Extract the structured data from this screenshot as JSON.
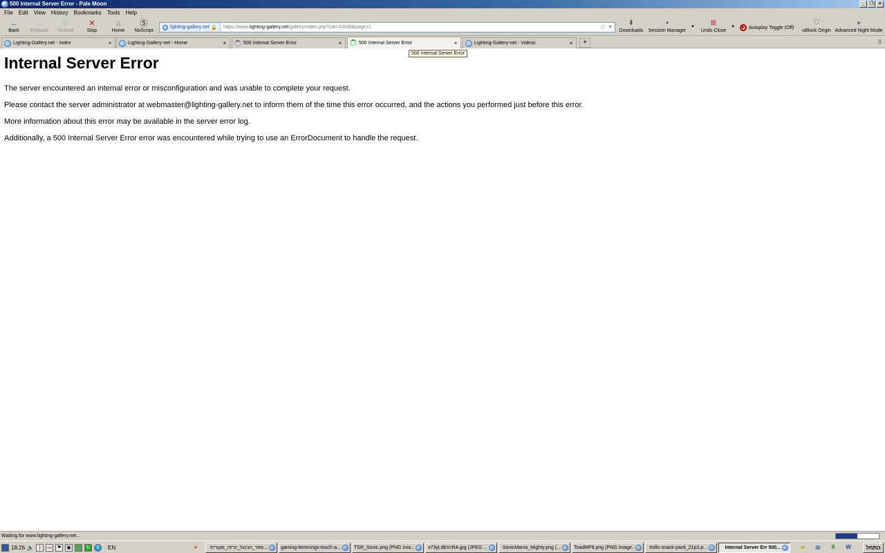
{
  "window": {
    "title": "500 Internal Server Error - Pale Moon",
    "controls": [
      "_",
      "❐",
      "×"
    ]
  },
  "menu": [
    "File",
    "Edit",
    "View",
    "History",
    "Bookmarks",
    "Tools",
    "Help"
  ],
  "nav": {
    "back": "Back",
    "forward": "Forward",
    "reload": "Reload",
    "stop": "Stop",
    "home": "Home",
    "noscript": "NoScript"
  },
  "urlbar": {
    "identity": "lighting-gallery.net",
    "url_prefix": "https://www.",
    "url_domain": "lighting-gallery.net",
    "url_path": "/gallery/index.php?cat=10338&page=1"
  },
  "toolbar": {
    "downloads": "Downloads",
    "session_manager": "Session Manager",
    "undo_close": "Undo Close",
    "autoplay": "Autoplay Toggle (Off)",
    "ublock": "uBlock Origin",
    "night_mode": "Advanced Night Mode"
  },
  "tabs": [
    {
      "title": "Lighting-Gallery.net - Index",
      "icon": "globe"
    },
    {
      "title": "Lighting-Gallery-net - Home",
      "icon": "globe"
    },
    {
      "title": "500 Internal Server Error",
      "icon": "spinner-grey"
    },
    {
      "title": "500 Internal Server Error",
      "icon": "spinner-green",
      "active": true
    },
    {
      "title": "Lighting-Gallery-net - Videos",
      "icon": "globe"
    }
  ],
  "tooltip": "500 Internal Server Error",
  "page": {
    "heading": "Internal Server Error",
    "p1": "The server encountered an internal error or misconfiguration and was unable to complete your request.",
    "p2": "Please contact the server administrator at webmaster@lighting-gallery.net to inform them of the time this error occurred, and the actions you performed just before this error.",
    "p3": "More information about this error may be available in the server error log.",
    "p4": "Additionally, a 500 Internal Server Error error was encountered while trying to use an ErrorDocument to handle the request."
  },
  "status": {
    "text": "Waiting for www.lighting-gallery.net...",
    "progress": 0.5
  },
  "taskbar": {
    "clock": "18:26",
    "lang": "EN",
    "buttons": [
      "ספר_הג'נגל_כרזה_מקורית...",
      "gaming-lemmings-touch-a...",
      "TSR_Sonic.png (PNG Ima...",
      "x73yLdbVcRA.jpg (JPEG ...",
      "SonicMania_Mighty.png (...",
      "ToadMP8.png (PNG Image...",
      "trolls-snack-pack_21p3.p...",
      "Internal Server Err 500..."
    ],
    "start": "התחל"
  }
}
